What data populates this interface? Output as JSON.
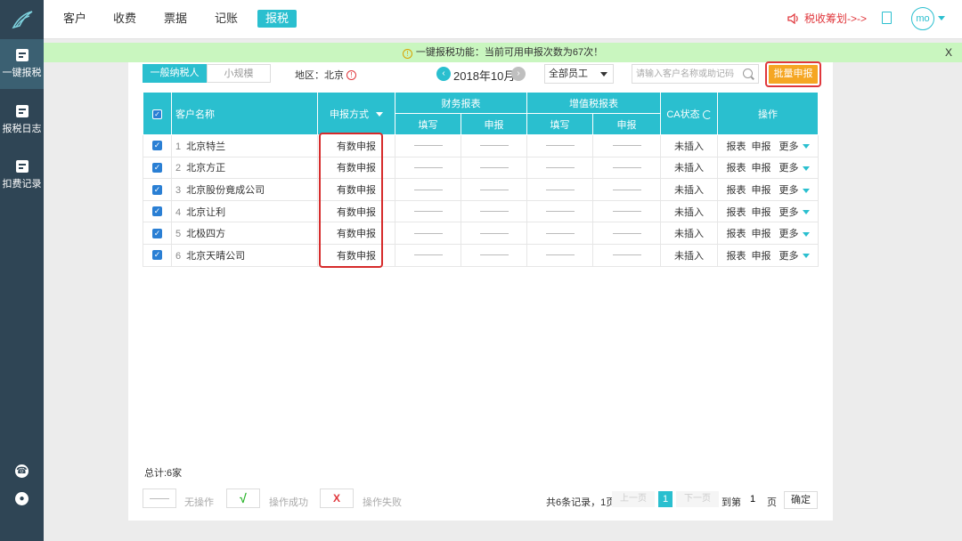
{
  "sidebar": {
    "logo": "logo-icon",
    "items": [
      {
        "label": "一键报税",
        "icon": "pencil-icon",
        "active": true
      },
      {
        "label": "报税日志",
        "icon": "log-icon"
      },
      {
        "label": "扣费记录",
        "icon": "receipt-icon"
      }
    ],
    "bottom_icons": [
      "phone-icon",
      "support-icon"
    ]
  },
  "topnav": {
    "items": [
      "客户",
      "收费",
      "票据",
      "记账",
      "报税"
    ],
    "active": "报税",
    "tax_plan": "税收筹划->->",
    "avatar": "mo"
  },
  "notice": {
    "text": "一键报税功能：当前可用申报次数为67次！",
    "close": "X"
  },
  "toolbar": {
    "tab_general": "一般纳税人",
    "tab_small": "小规模",
    "region": "地区：北京",
    "region_warn": "!",
    "month": "2018年10月",
    "employee": "全部员工",
    "search_placeholder": "请输入客户名称或助记码",
    "batch": "批量申报"
  },
  "table": {
    "headers": {
      "name": "客户名称",
      "method": "申报方式",
      "finance": "财务报表",
      "vat": "增值税报表",
      "fill": "填写",
      "declare": "申报",
      "ca": "CA状态",
      "ops": "操作"
    },
    "rows": [
      {
        "num": "1",
        "name": "北京特兰",
        "method": "有数申报",
        "ca": "未插入"
      },
      {
        "num": "2",
        "name": "北京方正",
        "method": "有数申报",
        "ca": "未插入"
      },
      {
        "num": "3",
        "name": "北京股份竟成公司",
        "method": "有数申报",
        "ca": "未插入"
      },
      {
        "num": "4",
        "name": "北京让利",
        "method": "有数申报",
        "ca": "未插入"
      },
      {
        "num": "5",
        "name": "北极四方",
        "method": "有数申报",
        "ca": "未插入"
      },
      {
        "num": "6",
        "name": "北京天晴公司",
        "method": "有数申报",
        "ca": "未插入"
      }
    ],
    "op_labels": [
      "报表",
      "申报",
      "更多"
    ]
  },
  "footer": {
    "total": "总计:6家",
    "legend_none": "无操作",
    "legend_success": "操作成功",
    "legend_fail": "操作失败",
    "success_mark": "√",
    "fail_mark": "X",
    "records": "共6条记录，1页",
    "prev": "上一页",
    "page": "1",
    "next": "下一页",
    "goto": "到第",
    "goto_value": "1",
    "page_unit": "页",
    "confirm": "确定"
  },
  "colors": {
    "accent": "#2abfcf",
    "sidebar": "#2f4555",
    "notice_bg": "#c9f6bf",
    "batch": "#f5a623",
    "highlight": "#d62b2b"
  }
}
